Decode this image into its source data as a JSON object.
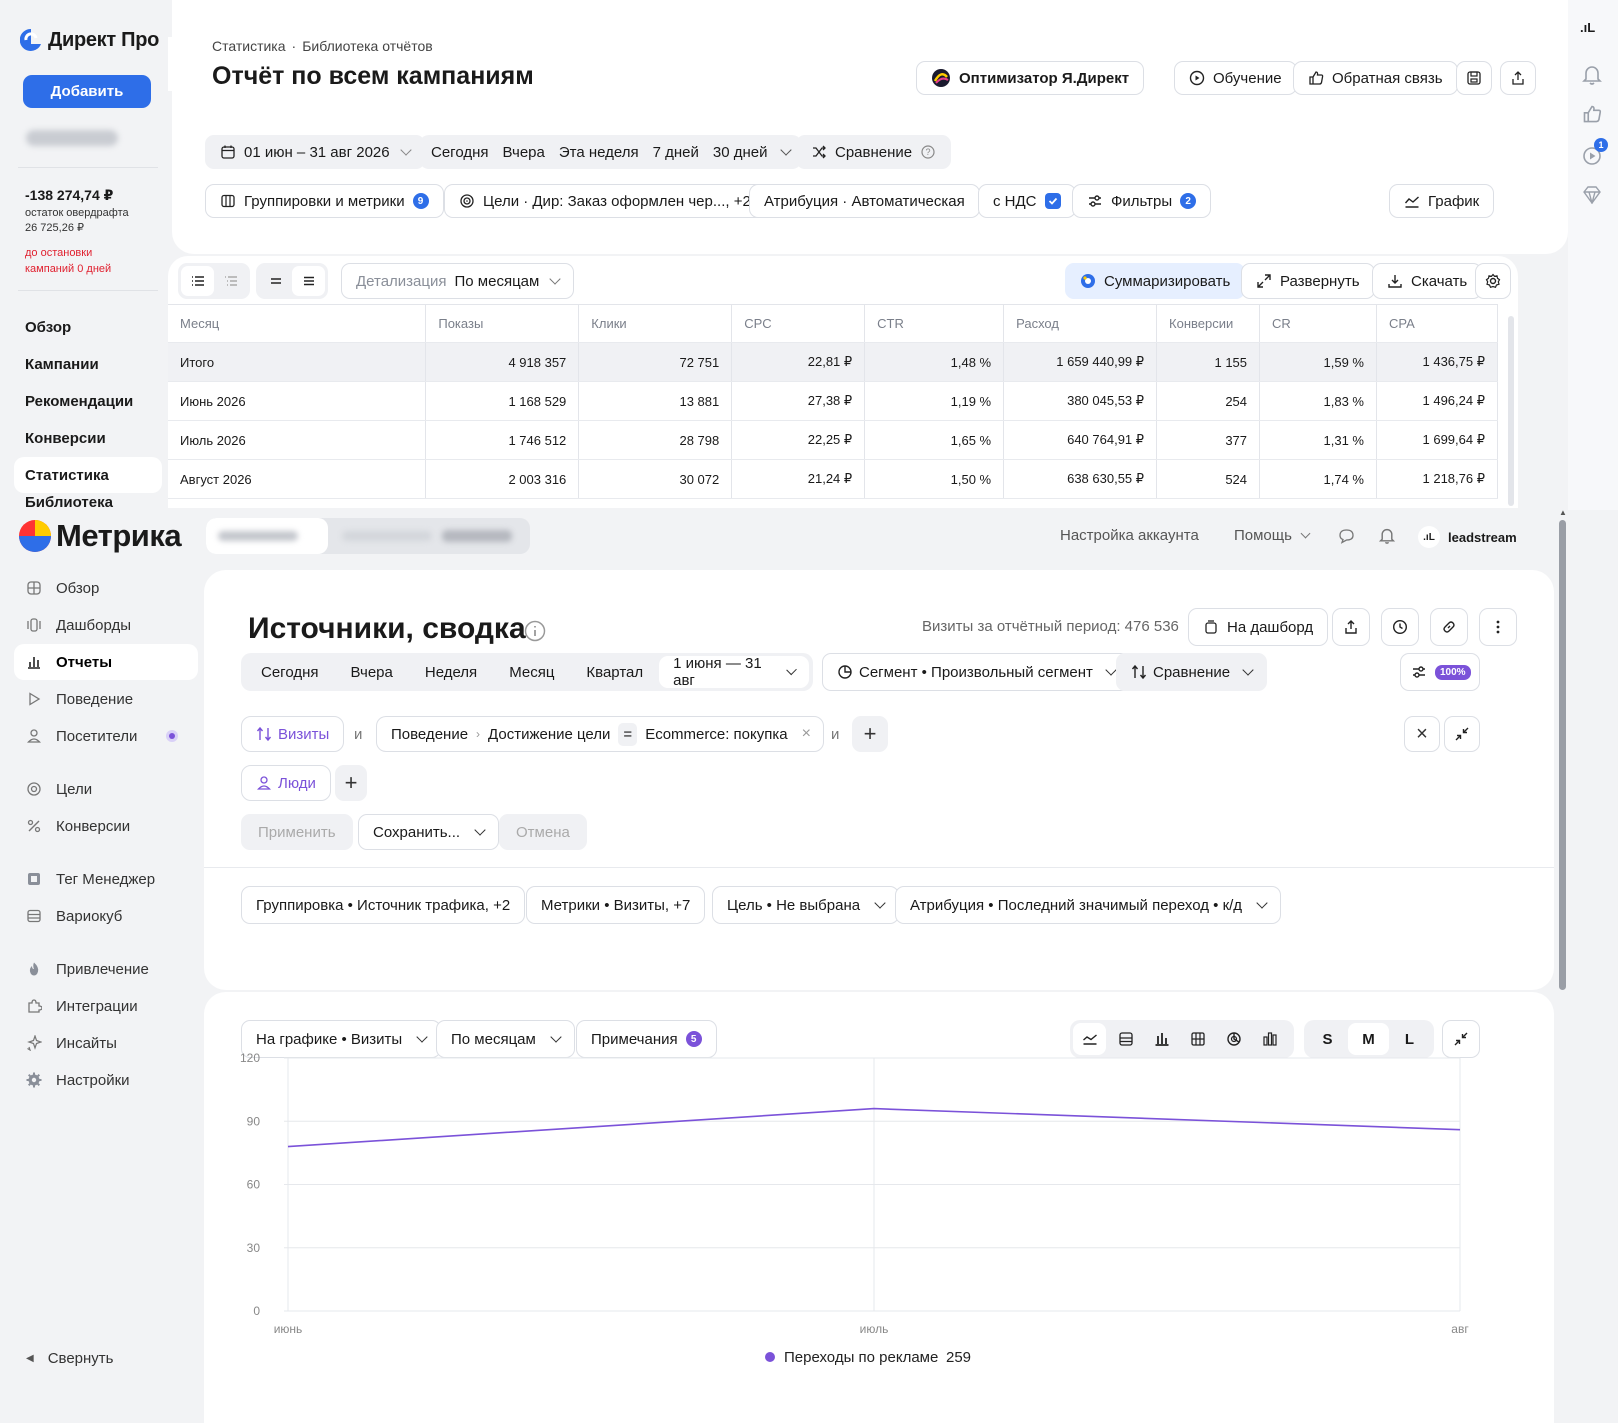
{
  "direct": {
    "logo_text": "Директ Про",
    "add_button": "Добавить",
    "balance": "-138 274,74 ₽",
    "overdraft_label": "остаток овердрафта",
    "overdraft_value": "26 725,26 ₽",
    "stop_warning_1": "до остановки",
    "stop_warning_2": "кампаний 0 дней",
    "nav": [
      "Обзор",
      "Кампании",
      "Рекомендации",
      "Конверсии",
      "Статистика",
      "Библиотека"
    ],
    "breadcrumb_1": "Статистика",
    "breadcrumb_2": "Библиотека отчётов",
    "title": "Отчёт по всем кампаниям",
    "optimizer_button": "Оптимизатор Я.Директ",
    "learning_button": "Обучение",
    "feedback_button": "Обратная связь",
    "date_range": "01 июн – 31 авг 2026",
    "periods": [
      "Сегодня",
      "Вчера",
      "Эта неделя",
      "7 дней",
      "30 дней"
    ],
    "compare_button": "Сравнение",
    "groupings_button": "Группировки и метрики",
    "groupings_count": "9",
    "goals_button": "Цели · Дир: Заказ оформлен чер..., +2",
    "attribution_button": "Атрибуция · Автоматическая",
    "vat_label": "с НДС",
    "filters_button": "Фильтры",
    "filters_count": "2",
    "chart_button": "График",
    "detail_label": "Детализация",
    "detail_value": "По месяцам",
    "summarize_button": "Суммаризировать",
    "expand_button": "Развернуть",
    "download_button": "Скачать",
    "table": {
      "headers": [
        "Месяц",
        "Показы",
        "Клики",
        "CPC",
        "CTR",
        "Расход",
        "Конверсии",
        "CR",
        "CPA"
      ],
      "rows": [
        [
          "Итого",
          "4 918 357",
          "72 751",
          "22,81 ₽",
          "1,48 %",
          "1 659 440,99 ₽",
          "1 155",
          "1,59 %",
          "1 436,75 ₽"
        ],
        [
          "Июнь 2026",
          "1 168 529",
          "13 881",
          "27,38 ₽",
          "1,19 %",
          "380 045,53 ₽",
          "254",
          "1,83 %",
          "1 496,24 ₽"
        ],
        [
          "Июль 2026",
          "1 746 512",
          "28 798",
          "22,25 ₽",
          "1,65 %",
          "640 764,91 ₽",
          "377",
          "1,31 %",
          "1 699,64 ₽"
        ],
        [
          "Август 2026",
          "2 003 316",
          "30 072",
          "21,24 ₽",
          "1,50 %",
          "638 630,55 ₽",
          "524",
          "1,74 %",
          "1 218,76 ₽"
        ]
      ]
    }
  },
  "metrika": {
    "logo_text": "Метрика",
    "account_settings": "Настройка аккаунта",
    "help": "Помощь",
    "username": "leadstream",
    "nav_1": [
      "Обзор",
      "Дашборды",
      "Отчеты",
      "Поведение",
      "Посетители"
    ],
    "nav_2": [
      "Цели",
      "Конверсии"
    ],
    "nav_3": [
      "Тег Менеджер",
      "Вариокуб"
    ],
    "nav_4": [
      "Привлечение",
      "Интеграции",
      "Инсайты",
      "Настройки"
    ],
    "collapse": "Свернуть",
    "title": "Источники, сводка",
    "visits_summary": "Визиты за отчётный период: 476 536",
    "dashboard_button": "На дашборд",
    "periods": [
      "Сегодня",
      "Вчера",
      "Неделя",
      "Месяц",
      "Квартал"
    ],
    "date_range": "1 июня — 31 авг",
    "segment_button": "Сегмент • Произвольный сегмент",
    "compare_button": "Сравнение",
    "sampling": "100%",
    "filter_visits": "Визиты",
    "and": "и",
    "filter_behavior": "Поведение",
    "filter_goal": "Достижение цели",
    "filter_eq": "=",
    "filter_value": "Ecommerce: покупка",
    "filter_people": "Люди",
    "apply_button": "Применить",
    "save_button": "Сохранить...",
    "cancel_button": "Отмена",
    "grouping_button": "Группировка • Источник трафика, +2",
    "metrics_button": "Метрики • Визиты, +7",
    "goal_button": "Цель • Не выбрана",
    "attribution_button": "Атрибуция • Последний значимый переход • к/д",
    "chart_metric_button": "На графике • Визиты",
    "chart_period_button": "По месяцам",
    "notes_button": "Примечания",
    "notes_count": "5",
    "sizes": [
      "S",
      "M",
      "L"
    ]
  },
  "chart_data": {
    "type": "line",
    "x": [
      "июнь",
      "июль",
      "авг"
    ],
    "series": [
      {
        "name": "Переходы по рекламе",
        "values": [
          78,
          96,
          86
        ]
      }
    ],
    "legend_total": "259",
    "yticks": [
      "0",
      "30",
      "60",
      "90",
      "120"
    ],
    "ylim": [
      0,
      120
    ],
    "grid": true,
    "legend": "bottom",
    "color": "#7b52d9"
  },
  "colors": {
    "accent": "#2e6ee8",
    "warning": "#e0202f",
    "purple": "#7b52d9"
  }
}
